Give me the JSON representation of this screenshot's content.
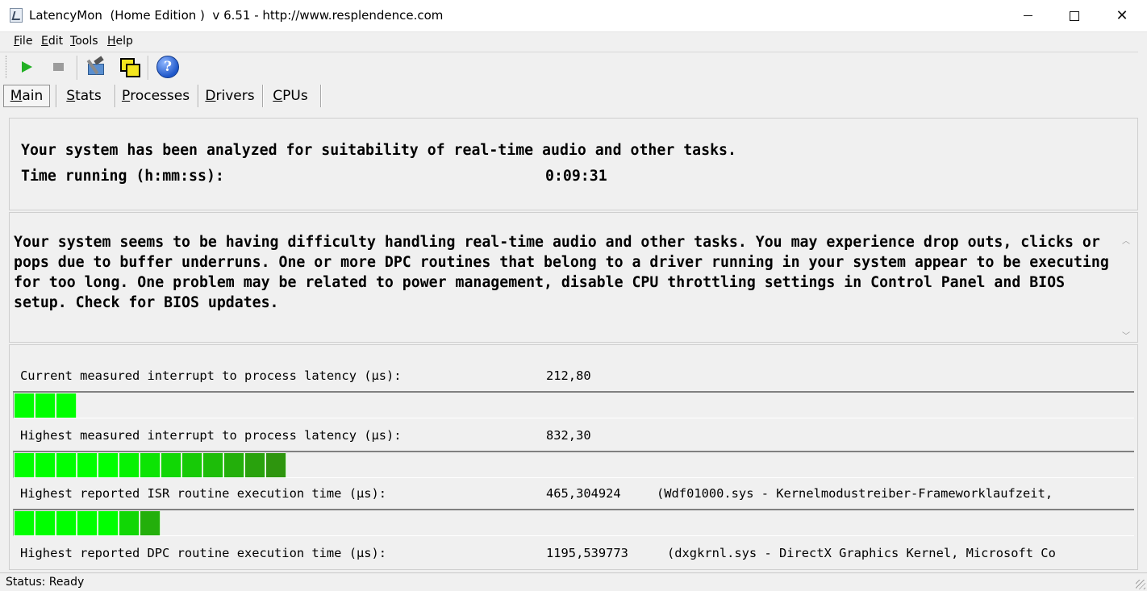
{
  "window": {
    "title": "LatencyMon  (Home Edition )  v 6.51 - http://www.resplendence.com"
  },
  "menu": {
    "items": [
      {
        "label_first": "F",
        "label_rest": "ile"
      },
      {
        "label_first": "E",
        "label_rest": "dit"
      },
      {
        "label_first": "T",
        "label_rest": "ools"
      },
      {
        "label_first": "H",
        "label_rest": "elp"
      }
    ]
  },
  "toolbar": {
    "icons": [
      "play-icon",
      "stop-icon",
      "hammer-monitor-icon",
      "windows-icon",
      "help-icon"
    ],
    "help_glyph": "?"
  },
  "tabs": [
    {
      "first": "M",
      "rest": "ain"
    },
    {
      "first": "S",
      "rest": "tats"
    },
    {
      "first": "P",
      "rest": "rocesses"
    },
    {
      "first": "D",
      "rest": "rivers"
    },
    {
      "first": "C",
      "rest": "PUs"
    }
  ],
  "summary": {
    "headline": "Your system has been analyzed for suitability of real-time audio and other tasks.",
    "time_label": "Time running (h:mm:ss):",
    "time_value": "0:09:31"
  },
  "description": "Your system seems to be having difficulty handling real-time audio and other tasks. You may experience drop outs, clicks or pops due to buffer underruns. One or more DPC routines that belong to a driver running in your system appear to be executing for too long. One problem may be related to power management, disable CPU throttling settings in Control Panel and BIOS setup. Check for BIOS updates.",
  "measurements": [
    {
      "label": "Current measured interrupt to process latency (µs):",
      "value": "212,80",
      "extra": "",
      "segments": 3
    },
    {
      "label": "Highest measured interrupt to process latency (µs):",
      "value": "832,30",
      "extra": "",
      "segments": 13
    },
    {
      "label": "Highest reported ISR routine execution time (µs):",
      "value": "465,304924",
      "extra": "(Wdf01000.sys - Kernelmodustreiber-Frameworklaufzeit,",
      "segments": 7
    },
    {
      "label": "Highest reported DPC routine execution time (µs):",
      "value": "1195,539773",
      "extra": "(dxgkrnl.sys - DirectX Graphics Kernel, Microsoft Co",
      "segments": 0
    }
  ],
  "status": {
    "text": "Status: Ready"
  },
  "colors": {
    "bar_bright": "#00ff00",
    "bar_dark": "#3a7a12"
  }
}
